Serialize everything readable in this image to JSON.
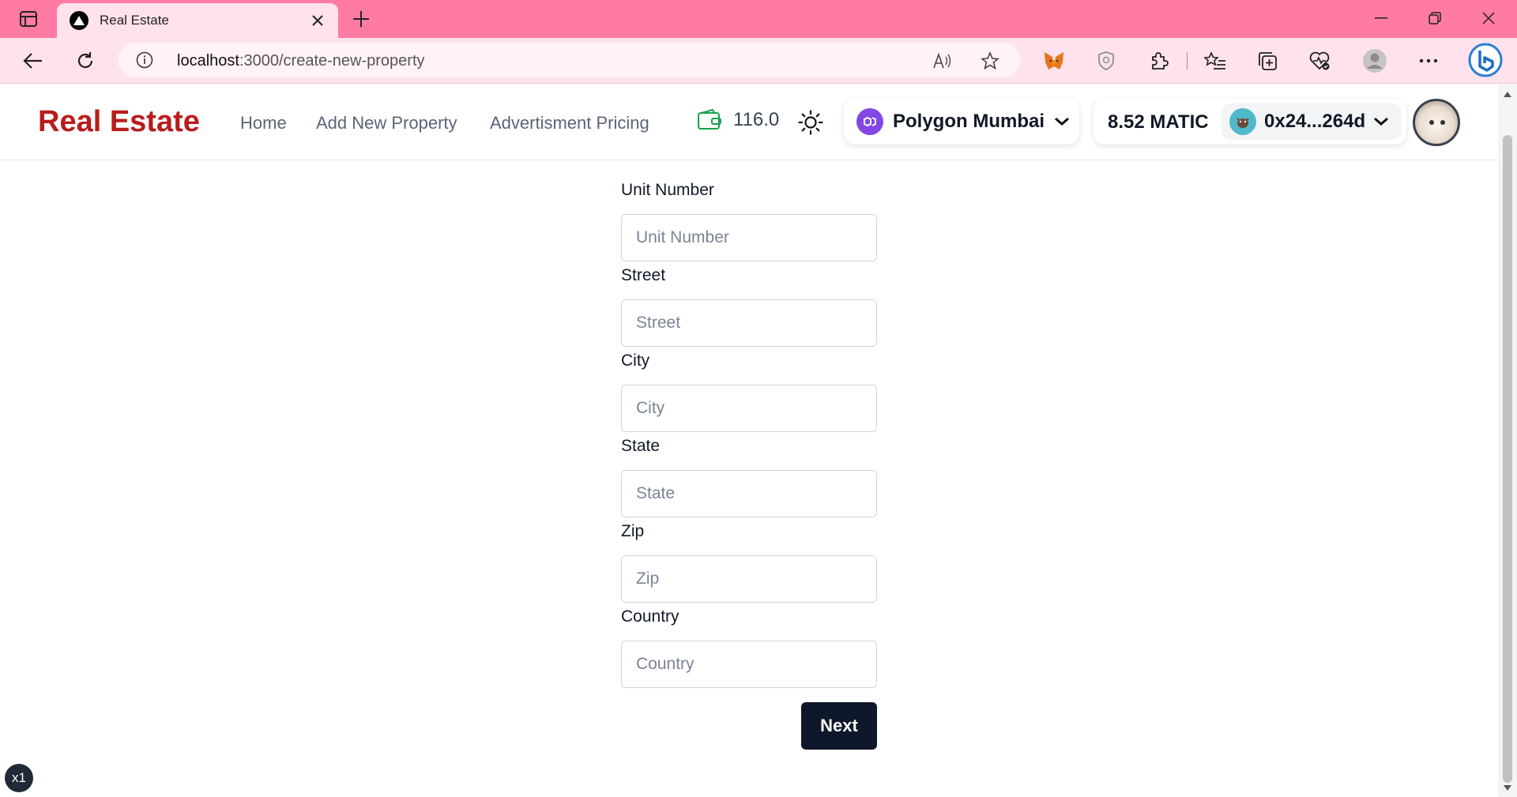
{
  "browser": {
    "tab_title": "Real Estate",
    "url_host": "localhost",
    "url_rest": ":3000/create-new-property"
  },
  "site": {
    "brand": "Real Estate",
    "nav": [
      {
        "label": "Home"
      },
      {
        "label": "Add New Property"
      },
      {
        "label": "Advertisment Pricing"
      }
    ],
    "wallet_balance": "116.0",
    "network": "Polygon Mumbai",
    "account_balance": "8.52 MATIC",
    "account_address": "0x24...264d"
  },
  "form": {
    "fields": [
      {
        "label": "Unit Number",
        "placeholder": "Unit Number"
      },
      {
        "label": "Street",
        "placeholder": "Street"
      },
      {
        "label": "City",
        "placeholder": "City"
      },
      {
        "label": "State",
        "placeholder": "State"
      },
      {
        "label": "Zip",
        "placeholder": "Zip"
      },
      {
        "label": "Country",
        "placeholder": "Country"
      }
    ],
    "submit_label": "Next"
  },
  "zoom_badge": "x1",
  "colors": {
    "tab_strip": "#ff7ba3",
    "toolbar": "#ffe2eb",
    "brand": "#b91c1c",
    "button_dark": "#0f172a",
    "polygon": "#8247e5"
  }
}
